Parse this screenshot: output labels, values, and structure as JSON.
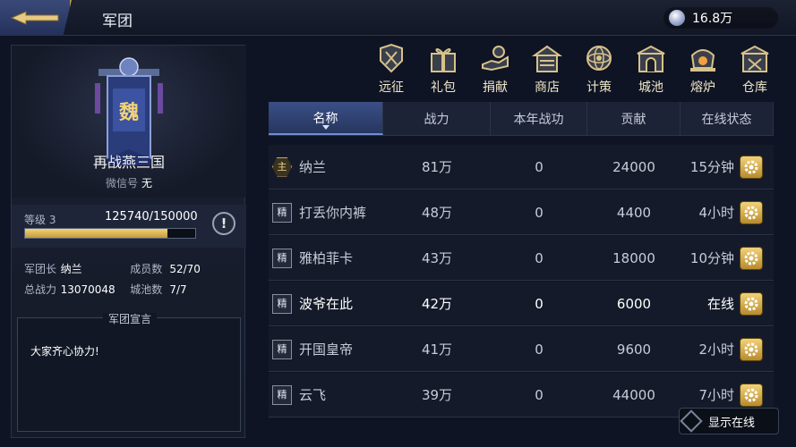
{
  "header": {
    "title": "军团",
    "currency_amount": "16.8万",
    "back_icon": "back-arrow-icon"
  },
  "legion": {
    "banner_char": "魏",
    "name": "再战燕三国",
    "wechat_label": "微信号",
    "wechat_value": "无",
    "level_label": "等级 3",
    "exp_text": "125740/150000",
    "exp_progress": 0.838,
    "stats": {
      "leader_label": "军团长",
      "leader_value": "纳兰",
      "members_label": "成员数",
      "members_value": "52/70",
      "power_label": "总战力",
      "power_value": "13070048",
      "cities_label": "城池数",
      "cities_value": "7/7"
    },
    "declaration_title": "军团宣言",
    "declaration_text": "大家齐心协力!"
  },
  "tabs": [
    {
      "label": "远征",
      "icon": "expedition-icon"
    },
    {
      "label": "礼包",
      "icon": "gift-icon"
    },
    {
      "label": "捐献",
      "icon": "donate-icon"
    },
    {
      "label": "商店",
      "icon": "shop-icon"
    },
    {
      "label": "计策",
      "icon": "strategy-icon"
    },
    {
      "label": "城池",
      "icon": "city-icon"
    },
    {
      "label": "熔炉",
      "icon": "furnace-icon"
    },
    {
      "label": "仓库",
      "icon": "warehouse-icon"
    }
  ],
  "table": {
    "columns": [
      "名称",
      "战力",
      "本年战功",
      "贡献",
      "在线状态"
    ],
    "rows": [
      {
        "rank": "主",
        "name": "纳兰",
        "power": "81万",
        "merit": "0",
        "contribution": "24000",
        "status": "15分钟"
      },
      {
        "rank": "精",
        "name": "打丢你内裤",
        "power": "48万",
        "merit": "0",
        "contribution": "4400",
        "status": "4小时"
      },
      {
        "rank": "精",
        "name": "雅柏菲卡",
        "power": "43万",
        "merit": "0",
        "contribution": "18000",
        "status": "10分钟"
      },
      {
        "rank": "精",
        "name": "波爷在此",
        "power": "42万",
        "merit": "0",
        "contribution": "6000",
        "status": "在线"
      },
      {
        "rank": "精",
        "name": "开国皇帝",
        "power": "41万",
        "merit": "0",
        "contribution": "9600",
        "status": "2小时"
      },
      {
        "rank": "精",
        "name": "云飞",
        "power": "39万",
        "merit": "0",
        "contribution": "44000",
        "status": "7小时"
      }
    ]
  },
  "show_online_label": "显示在线",
  "colors": {
    "accent_gold": "#f2d27a",
    "active_tab": "#3b4f86",
    "background": "#0e1424"
  }
}
